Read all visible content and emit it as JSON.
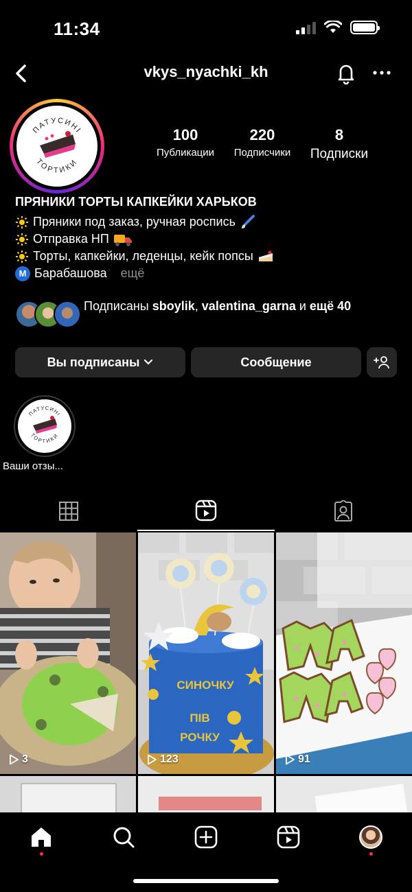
{
  "status_bar": {
    "time": "11:34"
  },
  "header": {
    "username": "vkys_nyachki_kh"
  },
  "profile": {
    "logo_text_top": "ПАТУСИНІ",
    "logo_text_bottom": "ТОРТИКИ",
    "stats": [
      {
        "value": "100",
        "label": "Публикации"
      },
      {
        "value": "220",
        "label": "Подписчики"
      },
      {
        "value": "8",
        "label": "Подписки"
      }
    ],
    "bio_name": "ПРЯНИКИ ТОРТЫ КАПКЕЙКИ ХАРЬКОВ",
    "bio_lines": [
      "Пряники под заказ, ручная роспись",
      "Отправка НП",
      "Торты, капкейки, леденцы, кейк попсы"
    ],
    "metro_label": "Барабашова",
    "more_label": "ещё",
    "followed_by": {
      "prefix": "Подписаны ",
      "user1": "sboylik",
      "sep": ", ",
      "user2": "valentina_garna",
      "and": " и ",
      "rest": "ещё 40"
    }
  },
  "buttons": {
    "following": "Вы подписаны",
    "message": "Сообщение"
  },
  "highlight": {
    "label": "Ваши отзы..."
  },
  "tabs": [
    "grid",
    "reels",
    "tagged"
  ],
  "grid": [
    {
      "views": "3"
    },
    {
      "views": "123",
      "cake_text_1": "СИНОЧКУ",
      "cake_text_2": "ПІВ",
      "cake_text_3": "РОЧКУ"
    },
    {
      "views": "91"
    }
  ],
  "icons": {
    "back": "chevron-left-icon",
    "bell": "bell-icon",
    "more": "more-horizontal-icon",
    "add_friend": "add-person-icon",
    "home": "home-icon",
    "search": "search-icon",
    "create": "plus-square-icon",
    "reels": "reels-icon",
    "profile": "avatar"
  },
  "colors": {
    "notification_dot": "#ff3040",
    "button_bg": "#262626",
    "metro": "#1f6bd8"
  }
}
